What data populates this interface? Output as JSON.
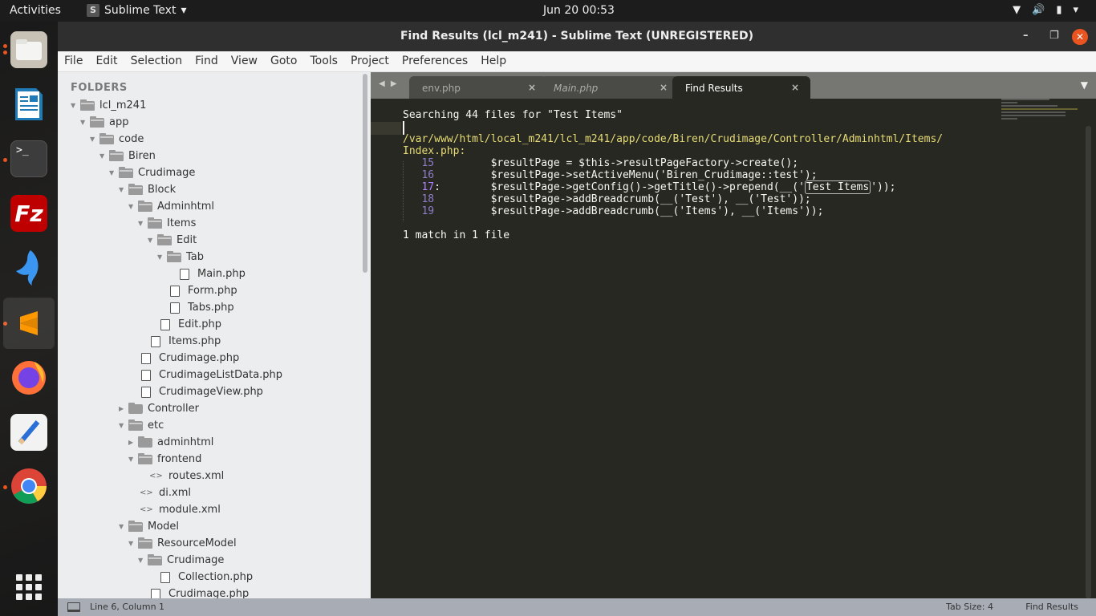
{
  "topbar": {
    "activities": "Activities",
    "app_name": "Sublime Text",
    "app_icon_glyph": "S",
    "clock": "Jun 20  00:53",
    "tray": [
      "wifi-icon",
      "volume-icon",
      "battery-icon",
      "system-menu-icon"
    ]
  },
  "dock": {
    "items": [
      {
        "name": "files",
        "icon": "folder-icon",
        "running": true
      },
      {
        "name": "libreoffice-writer",
        "icon": "document-icon",
        "running": false
      },
      {
        "name": "terminal",
        "icon": "terminal-icon",
        "running": true
      },
      {
        "name": "filezilla",
        "icon": "filezilla-icon",
        "running": false
      },
      {
        "name": "mysql-workbench",
        "icon": "dolphin-icon",
        "running": false
      },
      {
        "name": "sublime-text",
        "icon": "sublime-icon",
        "running": true,
        "active": true
      },
      {
        "name": "firefox",
        "icon": "firefox-icon",
        "running": false
      },
      {
        "name": "text-editor",
        "icon": "text-editor-icon",
        "running": false
      },
      {
        "name": "chrome",
        "icon": "chrome-icon",
        "running": true
      }
    ],
    "show_apps": "show-applications-icon"
  },
  "window": {
    "title": "Find Results (lcl_m241) - Sublime Text (UNREGISTERED)",
    "minimize": "–",
    "maximize": "❐",
    "close": "✕"
  },
  "menu": [
    "File",
    "Edit",
    "Selection",
    "Find",
    "View",
    "Goto",
    "Tools",
    "Project",
    "Preferences",
    "Help"
  ],
  "sidebar": {
    "header": "FOLDERS",
    "tree": [
      {
        "label": "lcl_m241",
        "type": "folder-open",
        "depth": 0
      },
      {
        "label": "app",
        "type": "folder-open",
        "depth": 1
      },
      {
        "label": "code",
        "type": "folder-open",
        "depth": 2
      },
      {
        "label": "Biren",
        "type": "folder-open",
        "depth": 3
      },
      {
        "label": "Crudimage",
        "type": "folder-open",
        "depth": 4
      },
      {
        "label": "Block",
        "type": "folder-open",
        "depth": 5
      },
      {
        "label": "Adminhtml",
        "type": "folder-open",
        "depth": 6
      },
      {
        "label": "Items",
        "type": "folder-open",
        "depth": 7
      },
      {
        "label": "Edit",
        "type": "folder-open",
        "depth": 8
      },
      {
        "label": "Tab",
        "type": "folder-open",
        "depth": 9
      },
      {
        "label": "Main.php",
        "type": "file",
        "depth": 10
      },
      {
        "label": "Form.php",
        "type": "file",
        "depth": 9
      },
      {
        "label": "Tabs.php",
        "type": "file",
        "depth": 9
      },
      {
        "label": "Edit.php",
        "type": "file",
        "depth": 8
      },
      {
        "label": "Items.php",
        "type": "file",
        "depth": 7
      },
      {
        "label": "Crudimage.php",
        "type": "file",
        "depth": 6
      },
      {
        "label": "CrudimageListData.php",
        "type": "file",
        "depth": 6
      },
      {
        "label": "CrudimageView.php",
        "type": "file",
        "depth": 6
      },
      {
        "label": "Controller",
        "type": "folder-closed",
        "depth": 5
      },
      {
        "label": "etc",
        "type": "folder-open",
        "depth": 5
      },
      {
        "label": "adminhtml",
        "type": "folder-closed",
        "depth": 6
      },
      {
        "label": "frontend",
        "type": "folder-open",
        "depth": 6
      },
      {
        "label": "routes.xml",
        "type": "xml",
        "depth": 7
      },
      {
        "label": "di.xml",
        "type": "xml",
        "depth": 6
      },
      {
        "label": "module.xml",
        "type": "xml",
        "depth": 6
      },
      {
        "label": "Model",
        "type": "folder-open",
        "depth": 5
      },
      {
        "label": "ResourceModel",
        "type": "folder-open",
        "depth": 6
      },
      {
        "label": "Crudimage",
        "type": "folder-open",
        "depth": 7
      },
      {
        "label": "Collection.php",
        "type": "file",
        "depth": 8
      },
      {
        "label": "Crudimage.php",
        "type": "file",
        "depth": 7
      }
    ]
  },
  "tabs": [
    {
      "label": "env.php",
      "active": false,
      "italic": false
    },
    {
      "label": "Main.php",
      "active": false,
      "italic": true
    },
    {
      "label": "Find Results",
      "active": true,
      "italic": false
    }
  ],
  "tab_close": "×",
  "editor": {
    "search_header": "Searching 44 files for \"Test Items\"",
    "file_path_1": "/var/www/html/local_m241/lcl_m241/app/code/Biren/Crudimage/Controller/Adminhtml/Items/",
    "file_path_2": "Index.php:",
    "lines": [
      {
        "num": "15",
        "sep": " ",
        "code": "        $resultPage = $this->resultPageFactory->create();",
        "match": false
      },
      {
        "num": "16",
        "sep": " ",
        "code": "        $resultPage->setActiveMenu('Biren_Crudimage::test');",
        "match": false
      },
      {
        "num": "17",
        "sep": ":",
        "code_before": "        $resultPage->getConfig()->getTitle()->prepend(__('",
        "match_text": "Test Items",
        "code_after": "'));",
        "match": true
      },
      {
        "num": "18",
        "sep": " ",
        "code": "        $resultPage->addBreadcrumb(__('Test'), __('Test'));",
        "match": false
      },
      {
        "num": "19",
        "sep": " ",
        "code": "        $resultPage->addBreadcrumb(__('Items'), __('Items'));",
        "match": false
      }
    ],
    "summary": "1 match in 1 file"
  },
  "status": {
    "position": "Line 6, Column 1",
    "tab_size": "Tab Size: 4",
    "syntax": "Find Results"
  }
}
